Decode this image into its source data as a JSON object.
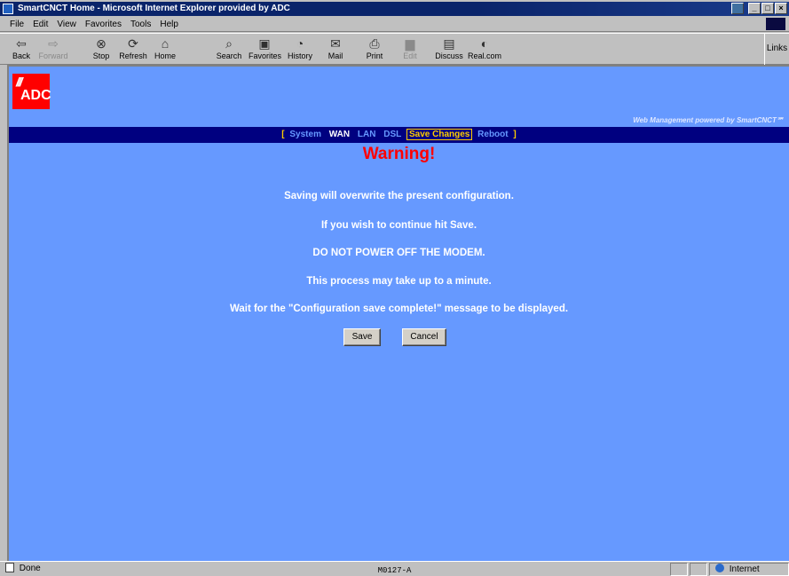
{
  "window": {
    "title": "SmartCNCT Home - Microsoft Internet Explorer provided by ADC"
  },
  "menu": [
    "File",
    "Edit",
    "View",
    "Favorites",
    "Tools",
    "Help"
  ],
  "toolbar": {
    "back": "Back",
    "forward": "Forward",
    "stop": "Stop",
    "refresh": "Refresh",
    "home": "Home",
    "search": "Search",
    "favorites": "Favorites",
    "history": "History",
    "mail": "Mail",
    "print": "Print",
    "edit": "Edit",
    "discuss": "Discuss",
    "realcom": "Real.com",
    "links": "Links"
  },
  "page": {
    "logo": "ADC",
    "powered_by": "Web Management powered by SmartCNCT℠",
    "nav": {
      "open": "[",
      "close": "]",
      "system": "System",
      "wan": "WAN",
      "lan": "LAN",
      "dsl": "DSL",
      "save_changes": "Save Changes",
      "reboot": "Reboot"
    },
    "warning_title": "Warning!",
    "messages": [
      "Saving will overwrite the present configuration.",
      "If you wish to continue hit Save.",
      "DO NOT POWER OFF THE MODEM.",
      "This process may take up to a minute.",
      "Wait for the \"Configuration save complete!\" message to be displayed."
    ],
    "save_label": "Save",
    "cancel_label": "Cancel"
  },
  "status": {
    "text": "Done",
    "zone": "Internet"
  },
  "figure_caption": "M0127-A"
}
